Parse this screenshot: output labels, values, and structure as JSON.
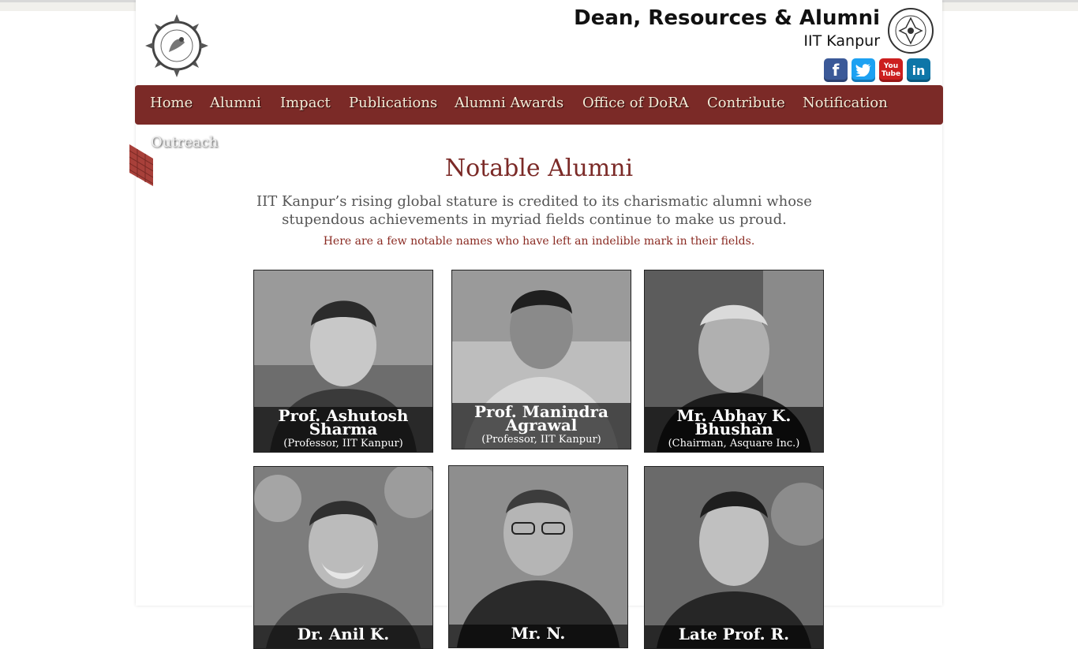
{
  "header": {
    "title": "Dean, Resources & Alumni",
    "subtitle": "IIT Kanpur",
    "logo_left": "share-your-news-and-knowledge-logo",
    "logo_right": "iit-kanpur-seal-logo",
    "social": [
      {
        "name": "facebook-icon",
        "glyph": "f"
      },
      {
        "name": "twitter-icon",
        "glyph": "t"
      },
      {
        "name": "youtube-icon",
        "glyph": "You Tube"
      },
      {
        "name": "linkedin-icon",
        "glyph": "in"
      }
    ]
  },
  "nav": {
    "items": [
      "Home",
      "Alumni",
      "Impact",
      "Publications",
      "Alumni Awards",
      "Office of DoRA",
      "Contribute",
      "Notification"
    ],
    "overflow_item": "Outreach"
  },
  "main": {
    "heading": "Notable Alumni",
    "intro": "IIT Kanpur’s rising global stature is credited to its charismatic alumni whose stupendous achievements in myriad fields continue to make us proud.",
    "subtext": "Here are a few notable names who have left an indelible mark in their fields."
  },
  "alumni": [
    {
      "name": "Prof. Ashutosh Sharma",
      "role": "(Professor, IIT Kanpur)"
    },
    {
      "name": "Prof. Manindra Agrawal",
      "role": "(Professor, IIT Kanpur)"
    },
    {
      "name": "Mr. Abhay K. Bhushan",
      "role": "(Chairman, Asquare Inc.)"
    },
    {
      "name": "Dr. Anil K.",
      "role": ""
    },
    {
      "name": "Mr. N.",
      "role": ""
    },
    {
      "name": "Late Prof. R.",
      "role": ""
    }
  ],
  "colors": {
    "accent": "#7b2a27",
    "nav_text": "#f6ecd8",
    "heading": "#7b2a27"
  }
}
